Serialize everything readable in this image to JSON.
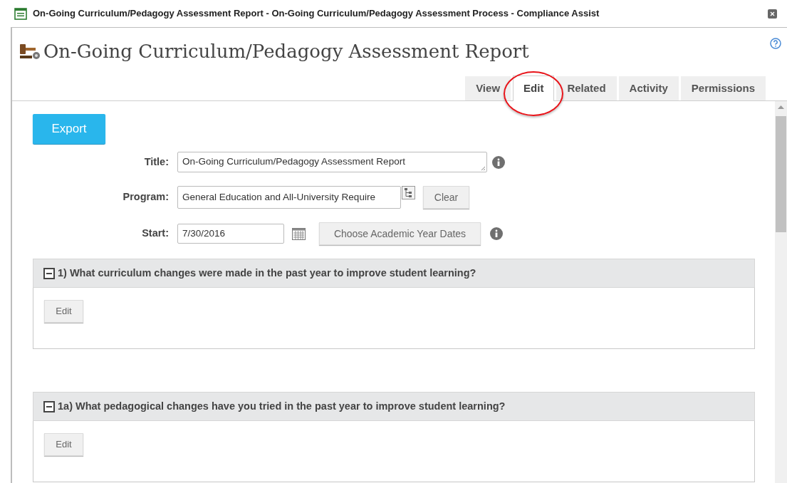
{
  "window": {
    "title": "On-Going Curriculum/Pedagogy Assessment Report - On-Going Curriculum/Pedagogy Assessment Process - Compliance Assist"
  },
  "page_title": "On-Going Curriculum/Pedagogy Assessment Report",
  "tabs": [
    {
      "label": "View",
      "selected": false
    },
    {
      "label": "Edit",
      "selected": true
    },
    {
      "label": "Related",
      "selected": false
    },
    {
      "label": "Activity",
      "selected": false
    },
    {
      "label": "Permissions",
      "selected": false
    }
  ],
  "export_button": "Export",
  "form": {
    "title": {
      "label": "Title:",
      "value": "On-Going Curriculum/Pedagogy Assessment Report"
    },
    "program": {
      "label": "Program:",
      "value": "General Education and All-University Require",
      "clear_button": "Clear"
    },
    "start": {
      "label": "Start:",
      "value": "7/30/2016",
      "dates_button": "Choose Academic Year Dates"
    }
  },
  "sections": [
    {
      "heading": "1) What curriculum changes were made in the past year to improve student learning?",
      "expanded": true,
      "edit_button": "Edit"
    },
    {
      "heading": "1a) What pedagogical changes have you tried in the past year to improve student learning?",
      "expanded": true,
      "edit_button": "Edit"
    }
  ]
}
